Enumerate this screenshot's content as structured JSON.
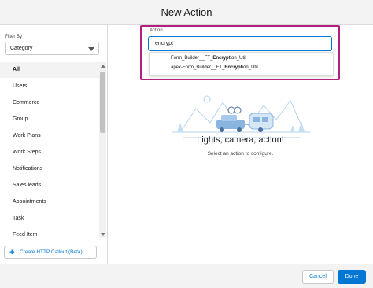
{
  "modal": {
    "title": "New Action"
  },
  "sidebar": {
    "filter_label": "Filter By",
    "filter_value": "Category",
    "items": [
      {
        "label": "All",
        "active": true
      },
      {
        "label": "Users"
      },
      {
        "label": "Commerce"
      },
      {
        "label": "Group"
      },
      {
        "label": "Work Plans"
      },
      {
        "label": "Work Steps"
      },
      {
        "label": "Notifications"
      },
      {
        "label": "Sales leads"
      },
      {
        "label": "Appointments"
      },
      {
        "label": "Task"
      },
      {
        "label": "Feed Item"
      }
    ],
    "callout_button": "Create HTTP Callout (Beta)"
  },
  "action": {
    "label": "Action",
    "search_value": "encrypt",
    "results": [
      {
        "prefix": "Form_Builder__FT_",
        "match": "Encrypt",
        "suffix": "ion_Util"
      },
      {
        "prefix": "apex-Form_Builder__FT_",
        "match": "Encrypt",
        "suffix": "ion_Util"
      }
    ]
  },
  "empty_state": {
    "title": "Lights, camera, action!",
    "subtitle": "Select an action to configure."
  },
  "footer": {
    "cancel": "Cancel",
    "done": "Done"
  },
  "colors": {
    "brand": "#0176d3",
    "highlight": "#b0207c",
    "header_bg": "#f3f3f3",
    "border": "#dddbda"
  }
}
